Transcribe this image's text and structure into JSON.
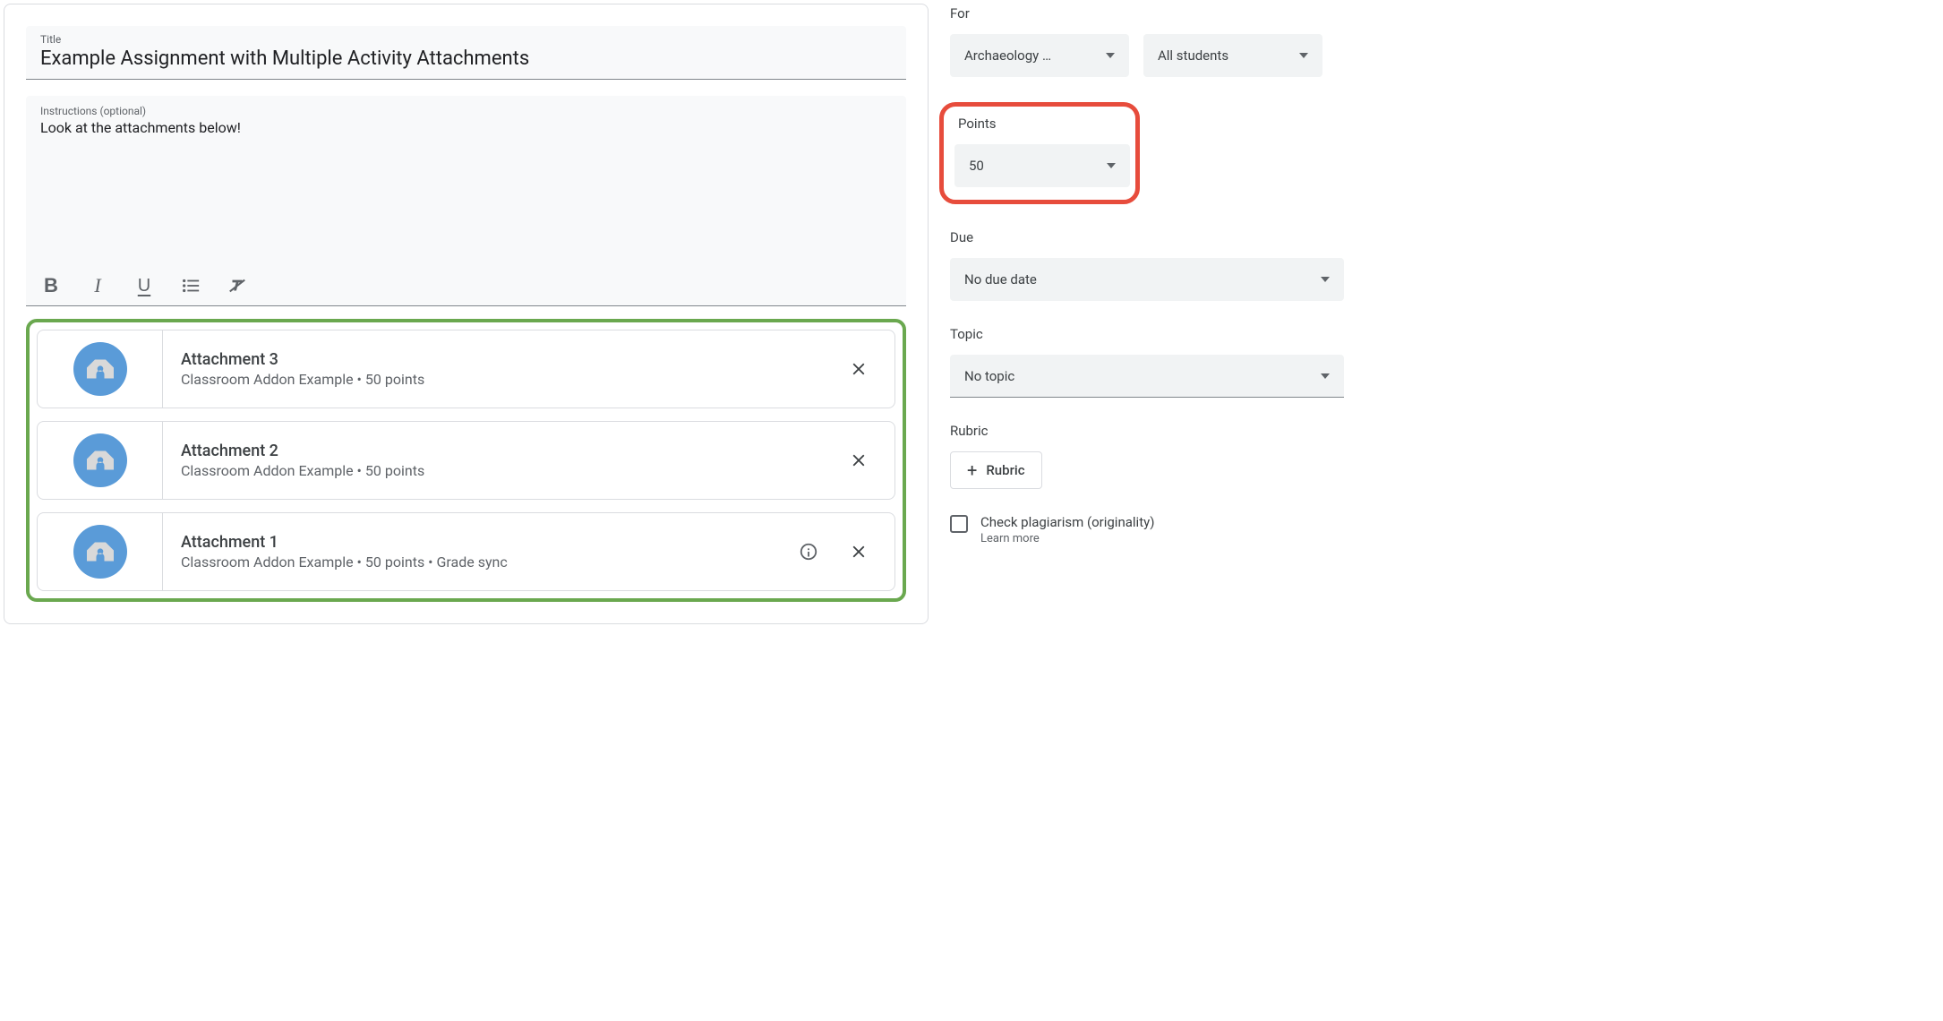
{
  "editor": {
    "title_label": "Title",
    "title_value": "Example Assignment with Multiple Activity Attachments",
    "instructions_label": "Instructions (optional)",
    "instructions_value": "Look at the attachments below!"
  },
  "attachments": [
    {
      "title": "Attachment 3",
      "subtitle": "Classroom Addon Example • 50 points",
      "info": false
    },
    {
      "title": "Attachment 2",
      "subtitle": "Classroom Addon Example • 50 points",
      "info": false
    },
    {
      "title": "Attachment 1",
      "subtitle": "Classroom Addon Example • 50 points • Grade sync",
      "info": true
    }
  ],
  "sidebar": {
    "for_label": "For",
    "for_class": "Archaeology …",
    "for_students": "All students",
    "points_label": "Points",
    "points_value": "50",
    "due_label": "Due",
    "due_value": "No due date",
    "topic_label": "Topic",
    "topic_value": "No topic",
    "rubric_label": "Rubric",
    "rubric_button": "Rubric",
    "plagiarism_label": "Check plagiarism (originality)",
    "learn_more": "Learn more"
  }
}
